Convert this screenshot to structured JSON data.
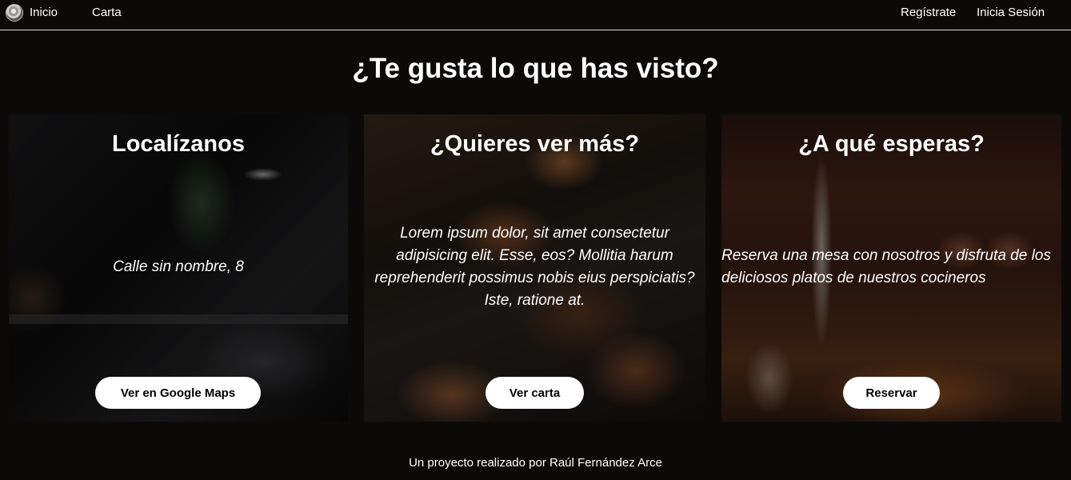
{
  "nav": {
    "logo_icon": "restaurant-logo-icon",
    "left": [
      {
        "label": "Inicio"
      },
      {
        "label": "Carta"
      }
    ],
    "right": [
      {
        "label": "Regístrate"
      },
      {
        "label": "Inicia Sesión"
      }
    ]
  },
  "heading": "¿Te gusta lo que has visto?",
  "cards": [
    {
      "title": "Localízanos",
      "text": "Calle sin nombre, 8",
      "button": "Ver en Google Maps",
      "image": "restaurant-interior-photo"
    },
    {
      "title": "¿Quieres ver más?",
      "text": "Lorem ipsum dolor, sit amet consectetur adipisicing elit. Esse, eos? Mollitia harum reprehenderit possimus nobis eius perspiciatis? Iste, ratione at.",
      "button": "Ver carta",
      "image": "grilled-chicken-wings-photo"
    },
    {
      "title": "¿A qué esperas?",
      "text": "Reserva una mesa con nosotros y disfruta de los deliciosos platos de nuestros cocineros",
      "button": "Reservar",
      "image": "candle-table-photo"
    }
  ],
  "footer": "Un proyecto realizado por Raúl Fernández Arce"
}
